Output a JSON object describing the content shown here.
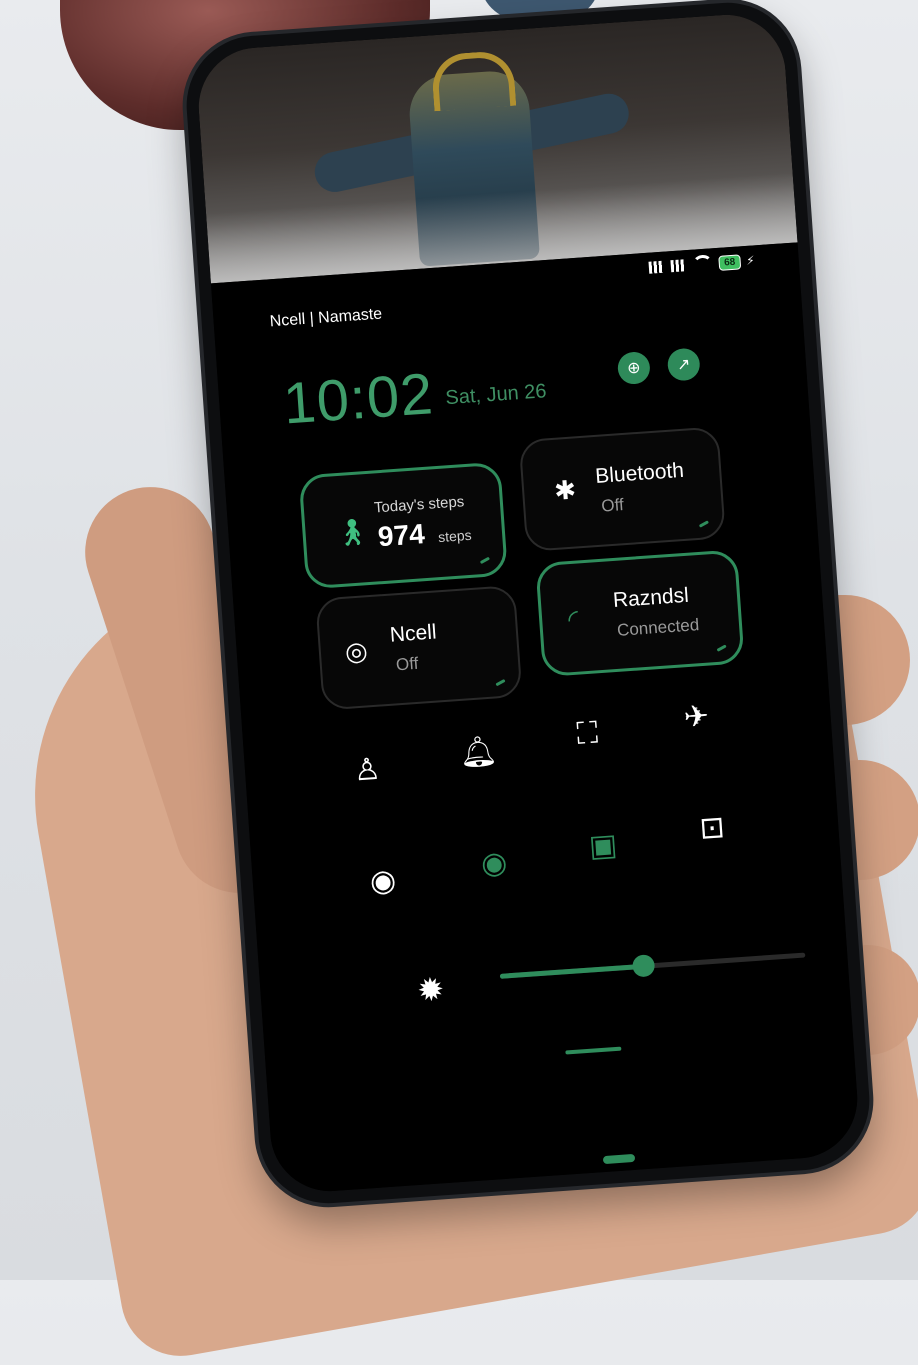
{
  "status_bar": {
    "battery": "68",
    "carrier": "Ncell | Namaste"
  },
  "header": {
    "time": "10:02",
    "date": "Sat, Jun 26",
    "icons": [
      "target-icon",
      "edit-icon"
    ]
  },
  "tiles": {
    "steps": {
      "label": "Today's steps",
      "value": "974",
      "unit": "steps",
      "icon": "walk-icon",
      "active": true
    },
    "bluetooth": {
      "title": "Bluetooth",
      "status": "Off",
      "icon": "bluetooth-icon",
      "active": false
    },
    "ncell": {
      "title": "Ncell",
      "status": "Off",
      "icon": "mobile-data-icon",
      "active": false
    },
    "wifi": {
      "title": "Razndsl",
      "status": "Connected",
      "icon": "wifi-icon",
      "active": true
    }
  },
  "quick_settings": [
    {
      "name": "flashlight-icon",
      "active": false
    },
    {
      "name": "alarm-bell-icon",
      "active": false
    },
    {
      "name": "screenshot-icon",
      "active": false
    },
    {
      "name": "airplane-icon",
      "active": false
    },
    {
      "name": "fingerprint-icon",
      "active": false
    },
    {
      "name": "location-icon",
      "active": true
    },
    {
      "name": "cast-icon",
      "active": true
    },
    {
      "name": "screen-record-icon",
      "active": false
    }
  ],
  "brightness": {
    "level_percent": 47
  },
  "colors": {
    "accent": "#2f8d5c",
    "clock": "#3f9c6a",
    "background": "#000000"
  }
}
